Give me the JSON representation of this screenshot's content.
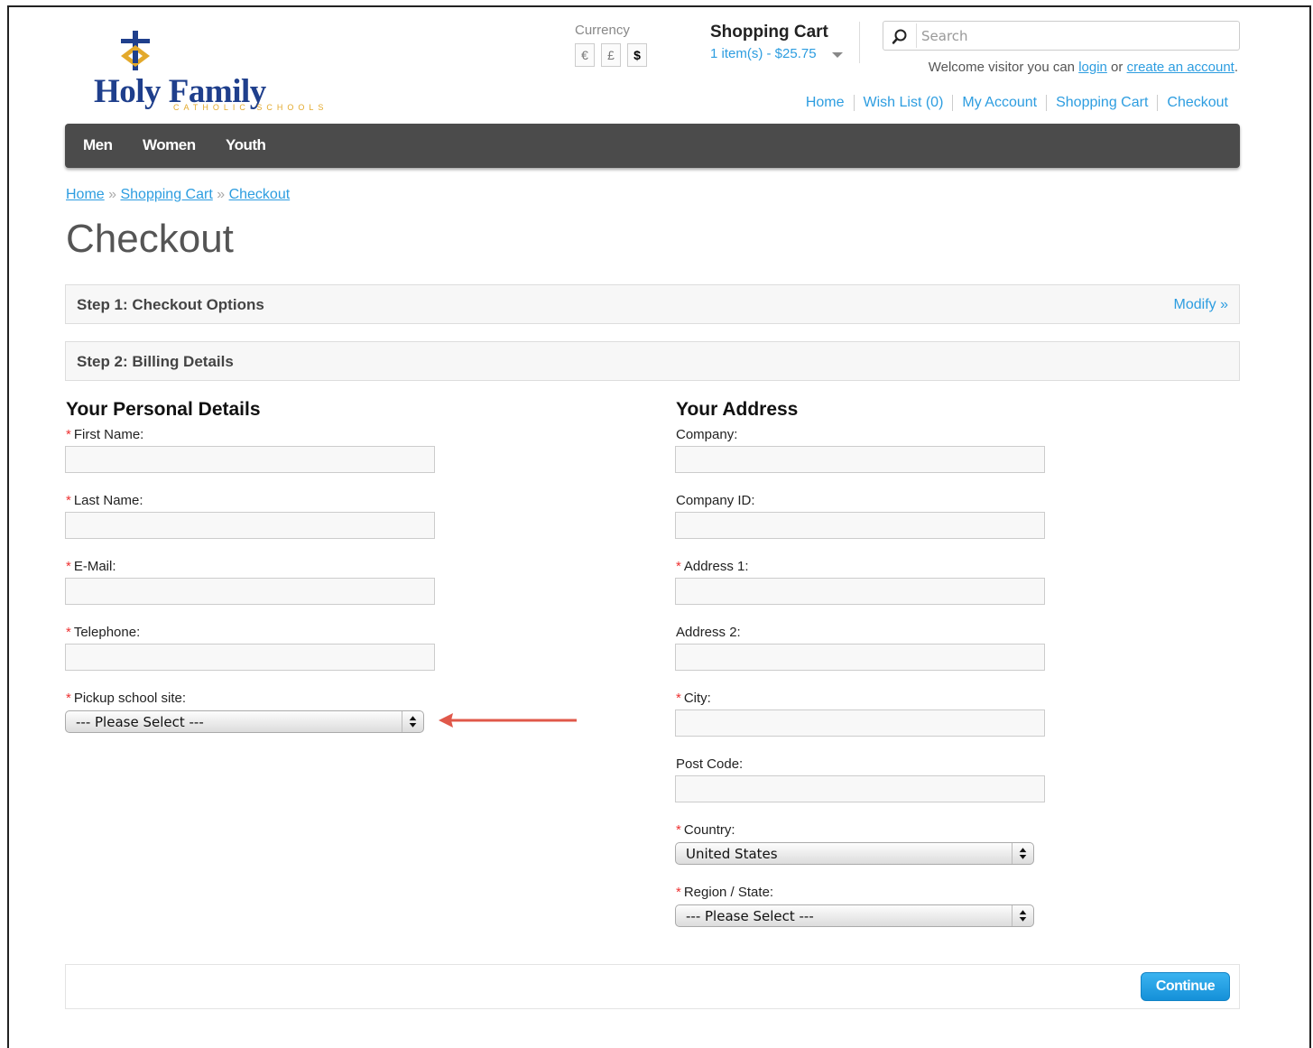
{
  "header": {
    "logo": {
      "name": "Holy Family",
      "tagline": "CATHOLIC SCHOOLS"
    },
    "currency": {
      "label": "Currency",
      "options": [
        "€",
        "£",
        "$"
      ],
      "selected": "$"
    },
    "cart": {
      "title": "Shopping Cart",
      "summary": "1 item(s) - $25.75"
    },
    "search": {
      "placeholder": "Search"
    },
    "welcome": {
      "prefix": "Welcome visitor you can ",
      "login": "login",
      "middle": " or ",
      "create": "create an account",
      "suffix": "."
    },
    "links": [
      "Home",
      "Wish List (0)",
      "My Account",
      "Shopping Cart",
      "Checkout"
    ]
  },
  "menu": [
    "Men",
    "Women",
    "Youth"
  ],
  "breadcrumb": {
    "items": [
      "Home",
      "Shopping Cart",
      "Checkout"
    ],
    "separator": " » "
  },
  "page_title": "Checkout",
  "steps": {
    "step1": {
      "title": "Step 1: Checkout Options",
      "modify": "Modify »"
    },
    "step2": {
      "title": "Step 2: Billing Details"
    }
  },
  "personal": {
    "heading": "Your Personal Details",
    "fields": [
      {
        "label": "First Name:",
        "required": true
      },
      {
        "label": "Last Name:",
        "required": true
      },
      {
        "label": "E-Mail:",
        "required": true
      },
      {
        "label": "Telephone:",
        "required": true
      }
    ],
    "pickup": {
      "label": "Pickup school site:",
      "required": true,
      "value": "--- Please Select ---"
    }
  },
  "address": {
    "heading": "Your Address",
    "fields": [
      {
        "label": "Company:",
        "required": false
      },
      {
        "label": "Company ID:",
        "required": false
      },
      {
        "label": "Address 1:",
        "required": true
      },
      {
        "label": "Address 2:",
        "required": false
      },
      {
        "label": "City:",
        "required": true
      },
      {
        "label": "Post Code:",
        "required": false
      }
    ],
    "country": {
      "label": "Country:",
      "required": true,
      "value": "United States"
    },
    "region": {
      "label": "Region / State:",
      "required": true,
      "value": "--- Please Select ---"
    }
  },
  "required_marker": "*",
  "continue_label": "Continue",
  "colors": {
    "link": "#2d9de0",
    "menubar": "#4b4b4b",
    "required": "#ee3333",
    "annotation_arrow": "#e0584a",
    "button": "#1a9ae0"
  }
}
